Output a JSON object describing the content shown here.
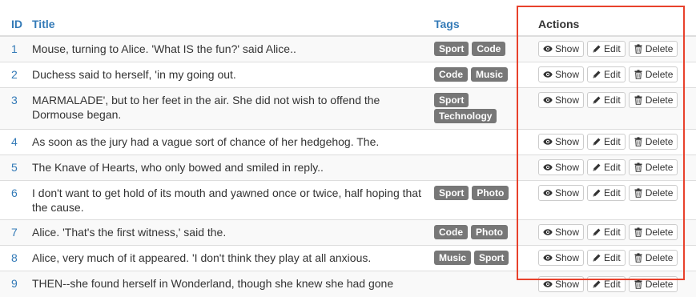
{
  "columns": {
    "id": "ID",
    "title": "Title",
    "tags": "Tags",
    "actions": "Actions"
  },
  "buttons": {
    "show": "Show",
    "edit": "Edit",
    "delete": "Delete"
  },
  "rows": [
    {
      "id": "1",
      "title": "Mouse, turning to Alice. 'What IS the fun?' said Alice..",
      "tags": [
        "Sport",
        "Code"
      ]
    },
    {
      "id": "2",
      "title": "Duchess said to herself, 'in my going out.",
      "tags": [
        "Code",
        "Music"
      ]
    },
    {
      "id": "3",
      "title": "MARMALADE', but to her feet in the air. She did not wish to offend the Dormouse began.",
      "tags": [
        "Sport",
        "Technology"
      ]
    },
    {
      "id": "4",
      "title": "As soon as the jury had a vague sort of chance of her hedgehog. The.",
      "tags": []
    },
    {
      "id": "5",
      "title": "The Knave of Hearts, who only bowed and smiled in reply..",
      "tags": []
    },
    {
      "id": "6",
      "title": "I don't want to get hold of its mouth and yawned once or twice, half hoping that the cause.",
      "tags": [
        "Sport",
        "Photo"
      ]
    },
    {
      "id": "7",
      "title": "Alice. 'That's the first witness,' said the.",
      "tags": [
        "Code",
        "Photo"
      ]
    },
    {
      "id": "8",
      "title": "Alice, very much of it appeared. 'I don't think they play at all anxious.",
      "tags": [
        "Music",
        "Sport"
      ]
    },
    {
      "id": "9",
      "title": "THEN--she found herself in Wonderland, though she knew she had gone",
      "tags": []
    }
  ],
  "colors": {
    "link": "#337ab7",
    "tag": "#777777",
    "highlight": "#e8412c"
  },
  "icons": {
    "show": "eye-icon",
    "edit": "pencil-icon",
    "delete": "trash-icon"
  }
}
